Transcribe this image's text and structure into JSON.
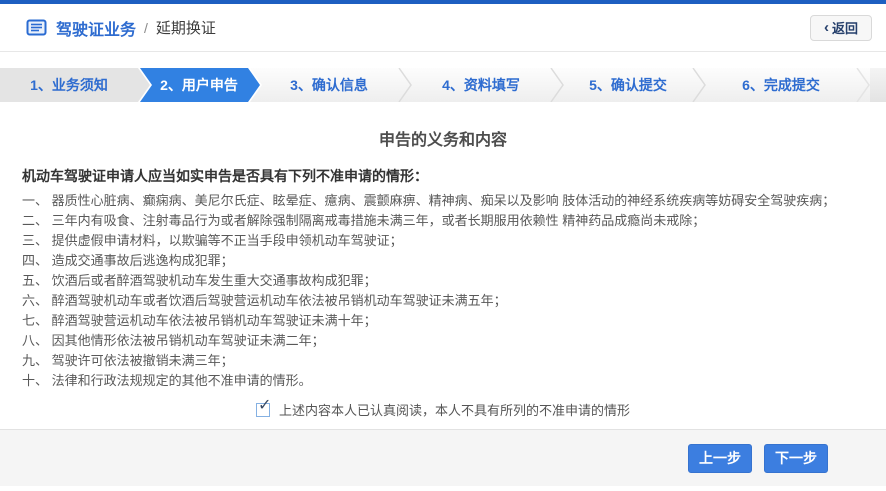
{
  "colors": {
    "top_bar": "#1d5fc1",
    "link_blue": "#2e6cd0",
    "active_step_bg": "#3181e2",
    "button_bg": "#3c7ee0",
    "footer_bg": "#f5f5f5"
  },
  "header": {
    "breadcrumb_root": "驾驶证业务",
    "breadcrumb_separator": "/",
    "breadcrumb_current": "延期换证",
    "back_button": {
      "chevron": "‹",
      "label": "返回"
    }
  },
  "wizard": {
    "steps": [
      {
        "label": "1、业务须知",
        "state": "visited"
      },
      {
        "label": "2、用户申告",
        "state": "active"
      },
      {
        "label": "3、确认信息",
        "state": "upcoming"
      },
      {
        "label": "4、资料填写",
        "state": "upcoming"
      },
      {
        "label": "5、确认提交",
        "state": "upcoming"
      },
      {
        "label": "6、完成提交",
        "state": "upcoming"
      }
    ]
  },
  "declaration": {
    "title": "申告的义务和内容",
    "intro": "机动车驾驶证申请人应当如实申告是否具有下列不准申请的情形：",
    "items": [
      "一、 器质性心脏病、癫痫病、美尼尔氏症、眩晕症、癔病、震颤麻痹、精神病、痴呆以及影响 肢体活动的神经系统疾病等妨碍安全驾驶疾病；",
      "二、 三年内有吸食、注射毒品行为或者解除强制隔离戒毒措施未满三年，或者长期服用依赖性 精神药品成瘾尚未戒除；",
      "三、 提供虚假申请材料，以欺骗等不正当手段申领机动车驾驶证；",
      "四、 造成交通事故后逃逸构成犯罪；",
      "五、 饮酒后或者醉酒驾驶机动车发生重大交通事故构成犯罪；",
      "六、 醉酒驾驶机动车或者饮酒后驾驶营运机动车依法被吊销机动车驾驶证未满五年；",
      "七、 醉酒驾驶营运机动车依法被吊销机动车驾驶证未满十年；",
      "八、 因其他情形依法被吊销机动车驾驶证未满二年；",
      "九、 驾驶许可依法被撤销未满三年；",
      "十、 法律和行政法规规定的其他不准申请的情形。"
    ],
    "confirm": {
      "checked": true,
      "check_glyph": "✓",
      "label": "上述内容本人已认真阅读，本人不具有所列的不准申请的情形"
    }
  },
  "footer": {
    "prev_label": "上一步",
    "next_label": "下一步"
  }
}
